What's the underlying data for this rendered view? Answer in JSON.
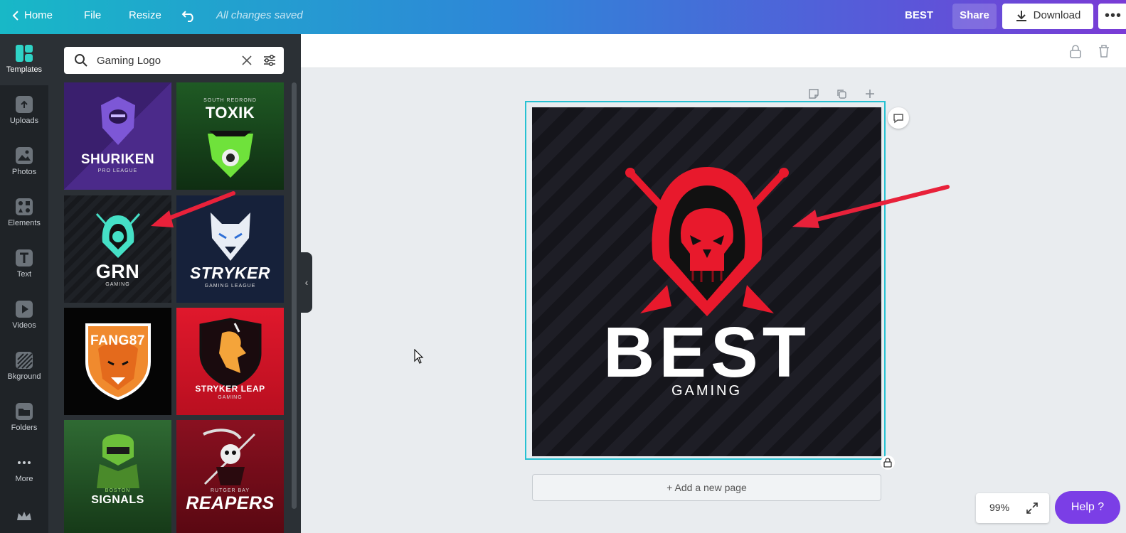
{
  "topbar": {
    "home_label": "Home",
    "file_label": "File",
    "resize_label": "Resize",
    "status": "All changes saved",
    "doc_title": "BEST",
    "share_label": "Share",
    "download_label": "Download"
  },
  "rail": {
    "items": [
      {
        "label": "Templates"
      },
      {
        "label": "Uploads"
      },
      {
        "label": "Photos"
      },
      {
        "label": "Elements"
      },
      {
        "label": "Text"
      },
      {
        "label": "Videos"
      },
      {
        "label": "Bkground"
      },
      {
        "label": "Folders"
      },
      {
        "label": "More"
      }
    ]
  },
  "search": {
    "value": "Gaming Logo"
  },
  "templates": [
    {
      "title": "SHURIKEN",
      "sub": "PRO LEAGUE",
      "bg": "#3a1f6e"
    },
    {
      "title": "TOXIK",
      "sub": "SOUTH REDROND",
      "bg": "#1d4a1f"
    },
    {
      "title": "GRN",
      "sub": "GAMING",
      "bg": "#17191d"
    },
    {
      "title": "STRYKER",
      "sub": "GAMING LEAGUE",
      "bg": "#16213a"
    },
    {
      "title": "FANG87",
      "sub": "",
      "bg": "#050505"
    },
    {
      "title": "STRYKER LEAP",
      "sub": "GAMING",
      "bg": "#d4172a"
    },
    {
      "title": "SIGNALS",
      "sub": "BOSTON",
      "bg": "#1e4a22"
    },
    {
      "title": "REAPERS",
      "sub": "RUTGER BAY",
      "bg": "#7a0f1d"
    }
  ],
  "canvas": {
    "title": "BEST",
    "subtitle": "GAMING",
    "add_page": "+ Add a new page"
  },
  "zoom": {
    "level": "99%"
  },
  "help": {
    "label": "Help ?"
  },
  "colors": {
    "accent": "#27c1d2",
    "logo_red": "#e8192c",
    "help": "#7b3ee6"
  }
}
